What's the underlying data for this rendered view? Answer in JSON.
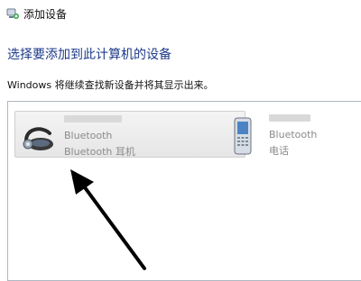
{
  "window": {
    "title": "添加设备",
    "icon": "add-device-icon"
  },
  "header": {
    "heading": "选择要添加到此计算机的设备",
    "subtext": "Windows 将继续查找新设备并将其显示出来。"
  },
  "devices": [
    {
      "type_line": "Bluetooth",
      "category_line": "Bluetooth 耳机",
      "icon": "bluetooth-headset-icon",
      "selected": true
    },
    {
      "type_line": "Bluetooth",
      "category_line": "电话",
      "icon": "mobile-phone-icon",
      "selected": false
    }
  ],
  "colors": {
    "heading": "#1e3a8a",
    "pane_border": "#aeb7c2",
    "selection_bg": "#e6e6e6",
    "muted_text": "#8a8a8a"
  },
  "annotation": {
    "icon": "black-arrow-annotation"
  }
}
